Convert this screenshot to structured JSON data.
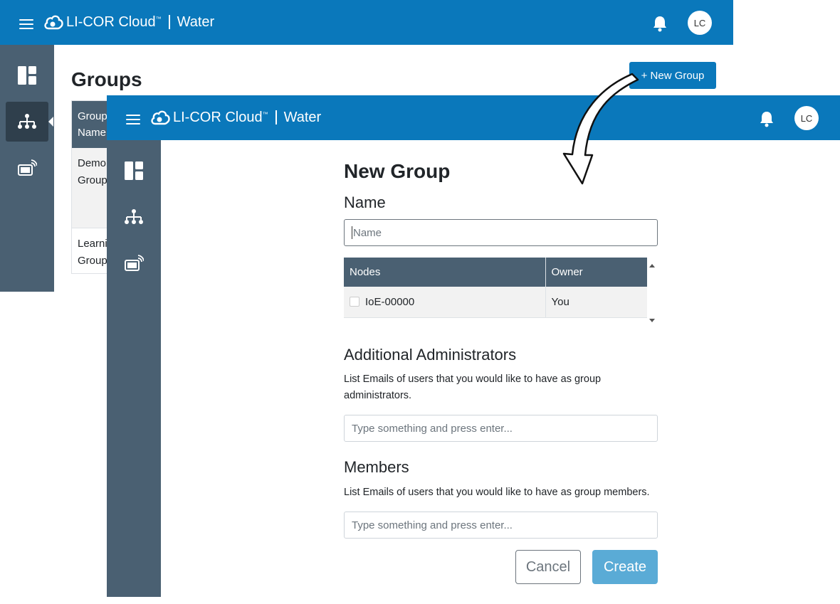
{
  "app": {
    "brand": "LI-COR Cloud",
    "trademark": "™",
    "product": "Water",
    "avatar_initials": "LC"
  },
  "background_page": {
    "title": "Groups",
    "new_group_button": "+ New Group",
    "table": {
      "header": "Group Name",
      "rows": [
        "Demo Group",
        "Learni Group"
      ]
    }
  },
  "new_group_form": {
    "title": "New Group",
    "name_label": "Name",
    "name_placeholder": "Name",
    "nodes_table": {
      "columns": [
        "Nodes",
        "Owner"
      ],
      "rows": [
        {
          "node": "IoE-00000",
          "owner": "You",
          "checked": false
        }
      ]
    },
    "admins_label": "Additional Administrators",
    "admins_help": "List Emails of users that you would like to have as group administrators.",
    "admins_placeholder": "Type something and press enter...",
    "members_label": "Members",
    "members_help": "List Emails of users that you would like to have as group members.",
    "members_placeholder": "Type something and press enter...",
    "cancel_label": "Cancel",
    "create_label": "Create"
  },
  "colors": {
    "topbar": "#0a78bb",
    "sidebar": "#4a6072",
    "create_button": "#5aabd6"
  },
  "icons": [
    "menu-icon",
    "cloud-logo-icon",
    "bell-icon",
    "dashboard-icon",
    "groups-icon",
    "devices-icon",
    "arrow-icon"
  ]
}
